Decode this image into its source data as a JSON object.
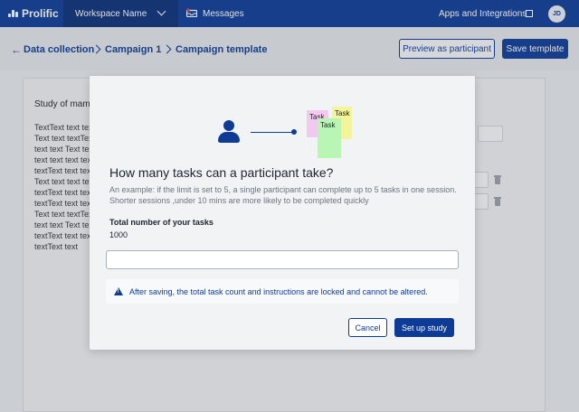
{
  "nav": {
    "logo": "Prolific",
    "workspace": "Workspace Name",
    "messages": "Messages",
    "apps": "Apps and Integrations",
    "avatar": "JD"
  },
  "breadcrumb": {
    "items": [
      "Data collection",
      "Campaign 1",
      "Campaign template"
    ]
  },
  "actions": {
    "preview": "Preview as participant",
    "save": "Save template"
  },
  "content": {
    "title": "Study of mamm",
    "lines": [
      "TextText text tex",
      "Text text textText",
      "text text Text tex",
      "text text text text",
      "textText text tex",
      "Text text text tex",
      "textText text tex",
      "textText text tex",
      "Text text textText",
      "text text Text tex",
      "textText text tex",
      "textText text"
    ]
  },
  "modal": {
    "illustration": {
      "notes": [
        "Task",
        "Task",
        "Task"
      ],
      "colors": [
        "#f3c9f0",
        "#b9f5b4",
        "#f4f59a"
      ]
    },
    "title": "How many tasks can a participant take?",
    "description": "An example: if the limit is set to 5, a single participant can complete up to 5 tasks in one session. Shorter sessions ,under 10 mins are more likely to be completed quickly",
    "field_label": "Total number of your tasks",
    "field_value": "1000",
    "input_value": "",
    "warning": "After saving, the total task count and instructions are locked and cannot be altered.",
    "cancel": "Cancel",
    "confirm": "Set up study"
  },
  "colors": {
    "brand": "#0d3b96",
    "nav_dark": "#0a2f78"
  }
}
